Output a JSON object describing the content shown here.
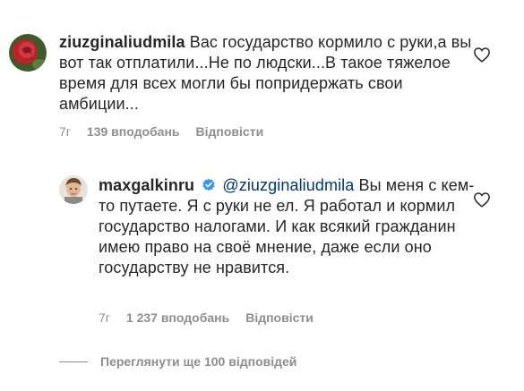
{
  "comments": [
    {
      "username": "ziuzginaliudmila",
      "text": "Вас государство кормило с руки,а вы вот так отплатили...Не по людски...В такое тяжелое время для всех могли бы попридержать свои амбиции...",
      "time": "7г",
      "likes": "139 вподобань",
      "reply_label": "Відповісти",
      "icon": "heart-outline-icon"
    },
    {
      "username": "maxgalkinru",
      "verified": true,
      "mention": "@ziuzginaliudmila",
      "text": "Вы меня с кем-то путаете. Я с руки не ел. Я работал и кормил государство налогами. И как всякий гражданин имею право на своё мнение, даже если оно государству не нравится.",
      "time": "7г",
      "likes": "1 237 вподобань",
      "reply_label": "Відповісти",
      "icon": "heart-outline-icon"
    }
  ],
  "view_replies_label": "Переглянути ще 100 відповідей",
  "colors": {
    "text": "#262626",
    "secondary": "#8e8e8e",
    "mention": "#00376b",
    "verified": "#3897f0"
  }
}
